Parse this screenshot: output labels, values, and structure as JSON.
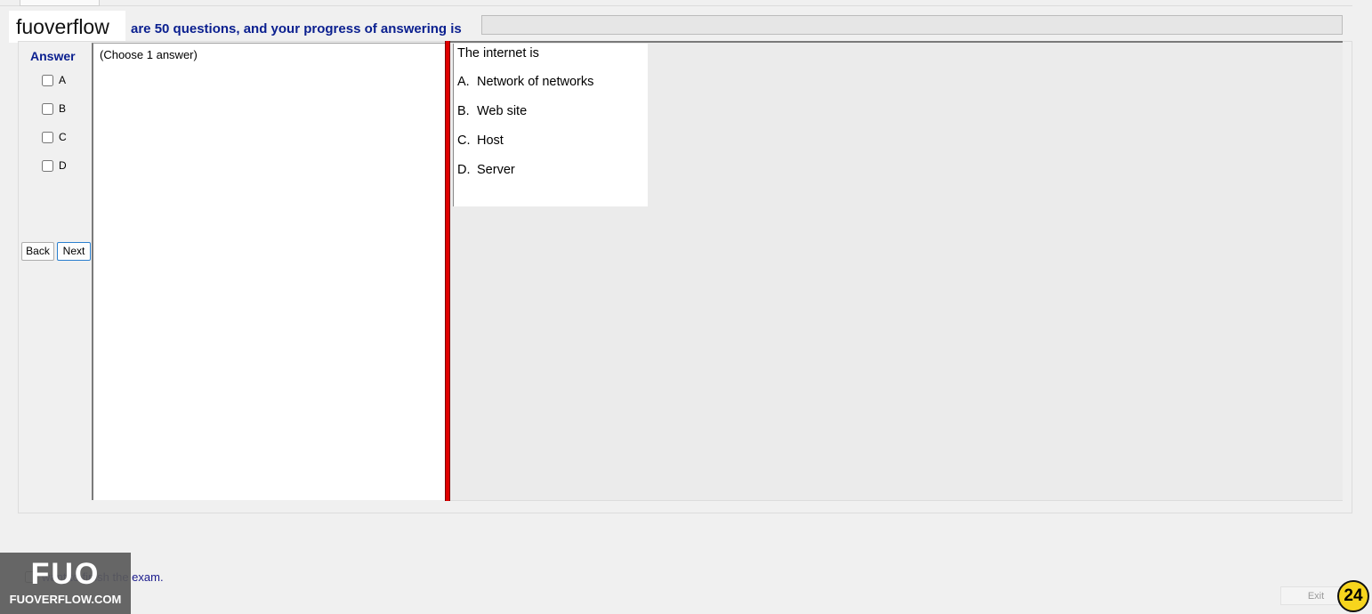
{
  "brand": {
    "text": "fuoverflow"
  },
  "header": {
    "progress_text": "are 50 questions, and your progress of answering is",
    "progress_fraction": 0
  },
  "answer_panel": {
    "title": "Answer",
    "options": [
      "A",
      "B",
      "C",
      "D"
    ],
    "back_label": "Back",
    "next_label": "Next"
  },
  "instruction": {
    "text": "(Choose 1 answer)"
  },
  "question": {
    "prompt": "The internet is",
    "choices": [
      {
        "letter": "A.",
        "text": "Network of networks"
      },
      {
        "letter": "B.",
        "text": "Web site"
      },
      {
        "letter": "C.",
        "text": "Host"
      },
      {
        "letter": "D.",
        "text": "Server"
      }
    ]
  },
  "footer": {
    "finish_text": "want to finish the exam.",
    "exit_label": "Exit",
    "page_number": "24"
  },
  "watermark": {
    "line1": "FUO",
    "line2": "FUOVERFLOW.COM"
  },
  "colors": {
    "accent_blue": "#0a1f8f",
    "splitter_red": "#e00000",
    "badge_yellow": "#f7d51d"
  }
}
